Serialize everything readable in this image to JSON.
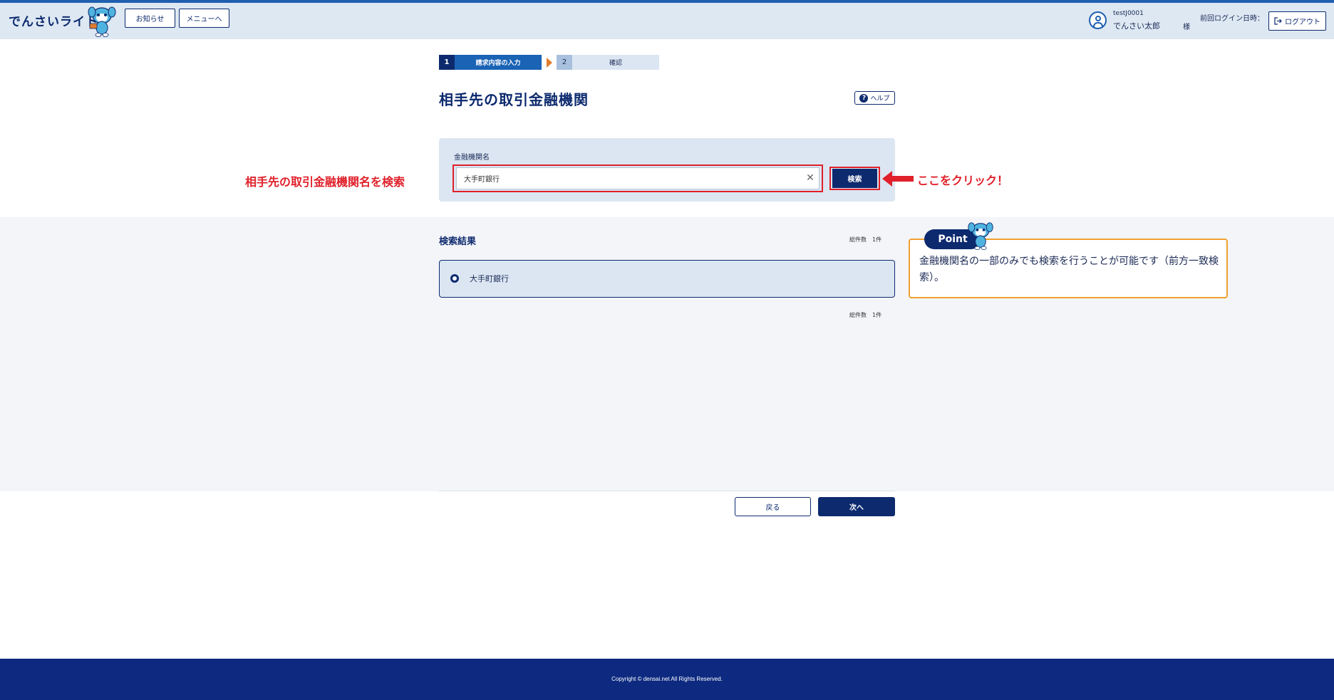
{
  "header": {
    "logo": "でんさいライト",
    "notice_button": "お知らせ",
    "menu_button": "メニューへ",
    "user_id": "testJ0001",
    "user_name": "でんさい太郎",
    "honorific": "様",
    "last_login_label": "前回ログイン日時：",
    "logout_button": "ログアウト"
  },
  "steps": [
    {
      "number": "1",
      "label": "請求内容の入力",
      "active": true
    },
    {
      "number": "2",
      "label": "確認",
      "active": false
    }
  ],
  "page": {
    "title": "相手先の取引金融機関",
    "help_button": "ヘルプ"
  },
  "search": {
    "field_label": "金融機関名",
    "value": "大手町銀行",
    "button": "検索"
  },
  "annotations": {
    "left": "相手先の取引金融機関名を検索",
    "right": "ここをクリック！",
    "color": "#e0202a"
  },
  "results": {
    "title": "検索結果",
    "count_label": "総件数　1件",
    "items": [
      {
        "label": "大手町銀行",
        "selected": true
      }
    ]
  },
  "point": {
    "badge": "Point",
    "text": "金融機関名の一部のみでも検索を行うことが可能です（前方一致検索）。"
  },
  "actions": {
    "back": "戻る",
    "next": "次へ"
  },
  "footer": {
    "copyright": "Copyright © densai.net All Rights Reserved."
  },
  "colors": {
    "brand": "#0d2a6e",
    "accent_blue": "#1a63b5",
    "panel": "#dbe6f2",
    "point_border": "#f0a030"
  }
}
